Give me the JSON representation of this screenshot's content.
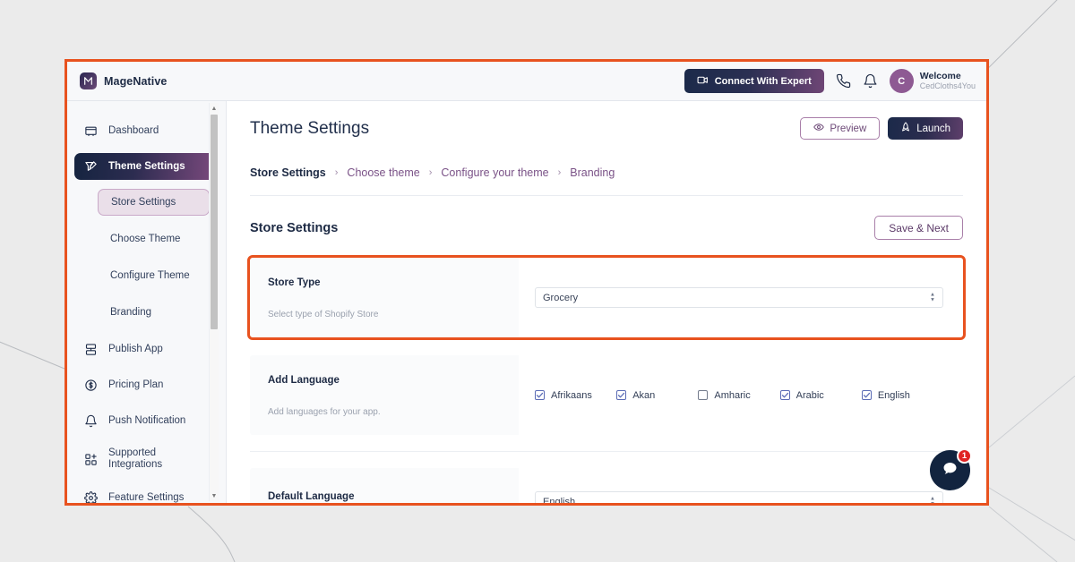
{
  "window": {
    "frame_border_color": "#e8521f",
    "background_color": "#ebebeb"
  },
  "topbar": {
    "brand_name": "MageNative",
    "brand_logo_icon": "magenative-logo-icon",
    "connect_button_label": "Connect With Expert",
    "connect_button_icon": "video-camera-icon",
    "phone_icon": "phone-icon",
    "bell_icon": "bell-icon",
    "avatar_initial": "C",
    "welcome_label": "Welcome",
    "username": "CedCloths4You"
  },
  "sidebar": {
    "items": [
      {
        "label": "Dashboard",
        "icon": "dashboard-icon",
        "active": false
      },
      {
        "label": "Theme Settings",
        "icon": "theme-settings-icon",
        "active": true
      },
      {
        "label": "Publish App",
        "icon": "publish-app-icon",
        "active": false
      },
      {
        "label": "Pricing Plan",
        "icon": "pricing-plan-icon",
        "active": false
      },
      {
        "label": "Push Notification",
        "icon": "bell-icon",
        "active": false
      },
      {
        "label": "Supported Integrations",
        "label_line1": "Supported",
        "label_line2": "Integrations",
        "icon": "integrations-icon",
        "active": false
      },
      {
        "label": "Feature Settings",
        "icon": "gear-icon",
        "active": false
      }
    ],
    "sub_items": [
      {
        "label": "Store Settings",
        "active": true
      },
      {
        "label": "Choose Theme",
        "active": false
      },
      {
        "label": "Configure Theme",
        "active": false
      },
      {
        "label": "Branding",
        "active": false
      }
    ]
  },
  "main": {
    "page_title": "Theme Settings",
    "preview_button_label": "Preview",
    "preview_button_icon": "eye-icon",
    "launch_button_label": "Launch",
    "launch_button_icon": "rocket-icon",
    "breadcrumb": [
      {
        "label": "Store Settings",
        "active": true
      },
      {
        "label": "Choose theme",
        "active": false
      },
      {
        "label": "Configure your theme",
        "active": false
      },
      {
        "label": "Branding",
        "active": false
      }
    ],
    "breadcrumb_separator": "›",
    "section_title": "Store Settings",
    "save_next_label": "Save & Next",
    "fields": {
      "store_type": {
        "label": "Store Type",
        "hint": "Select type of Shopify Store",
        "value": "Grocery",
        "highlighted": true
      },
      "add_language": {
        "label": "Add Language",
        "hint": "Add languages for your app.",
        "options": [
          {
            "label": "Afrikaans",
            "checked": true
          },
          {
            "label": "Akan",
            "checked": true
          },
          {
            "label": "Amharic",
            "checked": false
          },
          {
            "label": "Arabic",
            "checked": true
          },
          {
            "label": "English",
            "checked": true
          }
        ]
      },
      "default_language": {
        "label": "Default Language",
        "value": "English"
      }
    }
  },
  "chat_widget": {
    "icon": "chat-bubble-icon",
    "badge_count": "1"
  }
}
